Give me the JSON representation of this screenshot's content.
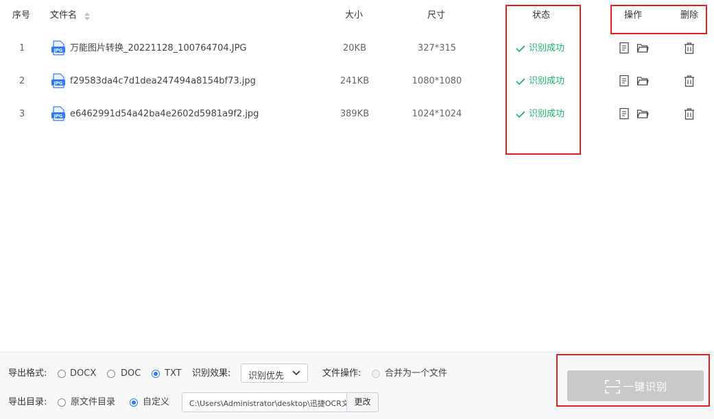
{
  "table": {
    "headers": {
      "index": "序号",
      "filename": "文件名",
      "size": "大小",
      "dimensions": "尺寸",
      "status": "状态",
      "actions": "操作",
      "delete": "删除"
    },
    "rows": [
      {
        "index": "1",
        "filename": "万能图片转换_20221128_100764704.JPG",
        "size": "20KB",
        "dimensions": "327*315",
        "status": "识别成功"
      },
      {
        "index": "2",
        "filename": "f29583da4c7d1dea247494a8154bf73.jpg",
        "size": "241KB",
        "dimensions": "1080*1080",
        "status": "识别成功"
      },
      {
        "index": "3",
        "filename": "e6462991d54a42ba4e2602d5981a9f2.jpg",
        "size": "389KB",
        "dimensions": "1024*1024",
        "status": "识别成功"
      }
    ],
    "file_badge": "JPG"
  },
  "footer": {
    "export_format_label": "导出格式:",
    "formats": [
      {
        "label": "DOCX",
        "selected": false
      },
      {
        "label": "DOC",
        "selected": false
      },
      {
        "label": "TXT",
        "selected": true
      }
    ],
    "effect_label": "识别效果:",
    "effect_value": "识别优先",
    "file_op_label": "文件操作:",
    "merge_label": "合并为一个文件",
    "export_dir_label": "导出目录:",
    "dir_options": [
      {
        "label": "原文件目录",
        "selected": false
      },
      {
        "label": "自定义",
        "selected": true
      }
    ],
    "path": "C:\\Users\\Administrator\\desktop\\迅捷OCR文",
    "change_label": "更改",
    "ocr_button": "一键识别"
  },
  "colors": {
    "success": "#1fb36a",
    "accent": "#2f7cf6",
    "annotation": "#e02020",
    "disabled_button": "#c9c9cb"
  }
}
